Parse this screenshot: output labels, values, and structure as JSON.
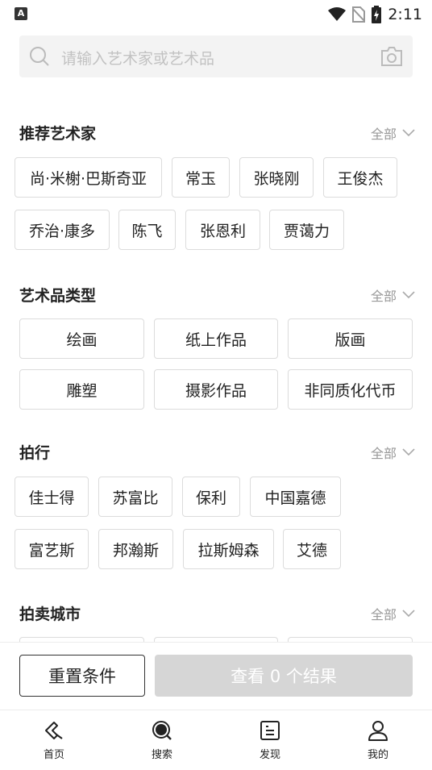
{
  "status_bar": {
    "time": "2:11",
    "left_badge": "A"
  },
  "search": {
    "placeholder": "请输入艺术家或艺术品"
  },
  "all_label": "全部",
  "sections": {
    "artists": {
      "title": "推荐艺术家",
      "items": [
        "尚·米榭·巴斯奇亚",
        "常玉",
        "张晓刚",
        "王俊杰",
        "乔治·康多",
        "陈飞",
        "张恩利",
        "贾蔼力"
      ]
    },
    "types": {
      "title": "艺术品类型",
      "items": [
        "绘画",
        "纸上作品",
        "版画",
        "雕塑",
        "摄影作品",
        "非同质化代币"
      ]
    },
    "auction_houses": {
      "title": "拍行",
      "items": [
        "佳士得",
        "苏富比",
        "保利",
        "中国嘉德",
        "富艺斯",
        "邦瀚斯",
        "拉斯姆森",
        "艾德"
      ]
    },
    "cities": {
      "title": "拍卖城市"
    }
  },
  "actions": {
    "reset": "重置条件",
    "view": "查看 0 个结果"
  },
  "nav": {
    "home": "首页",
    "search": "搜索",
    "discover": "发现",
    "mine": "我的"
  },
  "colors": {
    "accent": "#222222",
    "disabled_button": "#d6d6d6",
    "muted_text": "#999999"
  }
}
